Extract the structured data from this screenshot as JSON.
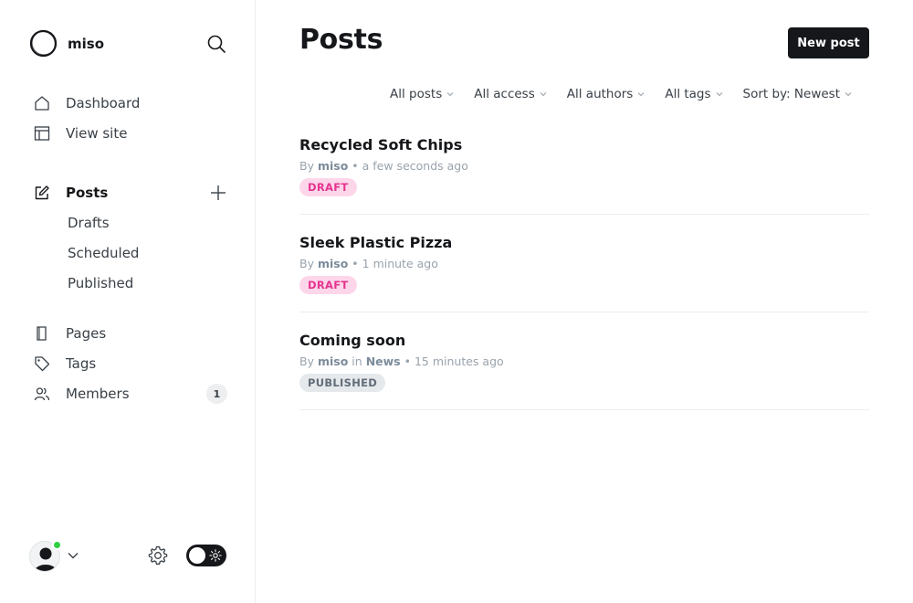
{
  "brand": {
    "name": "miso"
  },
  "nav": {
    "primary": [
      {
        "label": "Dashboard",
        "icon": "house-icon"
      },
      {
        "label": "View site",
        "icon": "layout-icon"
      }
    ],
    "posts": {
      "label": "Posts",
      "icon": "pencil-square-icon"
    },
    "post_subitems": [
      "Drafts",
      "Scheduled",
      "Published"
    ],
    "secondary": [
      {
        "label": "Pages",
        "icon": "page-icon"
      },
      {
        "label": "Tags",
        "icon": "tag-icon"
      },
      {
        "label": "Members",
        "icon": "members-icon",
        "count": "1"
      }
    ]
  },
  "main": {
    "title": "Posts",
    "new_post_label": "New post",
    "filters": [
      "All posts",
      "All access",
      "All authors",
      "All tags",
      "Sort by: Newest"
    ]
  },
  "posts": [
    {
      "title": "Recycled Soft Chips",
      "by": "By",
      "author": "miso",
      "in": "",
      "tag": "",
      "time": "a few seconds ago",
      "status": "DRAFT"
    },
    {
      "title": "Sleek Plastic Pizza",
      "by": "By",
      "author": "miso",
      "in": "",
      "tag": "",
      "time": "1 minute ago",
      "status": "DRAFT"
    },
    {
      "title": "Coming soon",
      "by": "By",
      "author": "miso",
      "in": "in",
      "tag": "News",
      "time": "15 minutes ago",
      "status": "PUBLISHED"
    }
  ],
  "colors": {
    "accent_dark": "#15171a",
    "draft_bg": "#fdd6ea",
    "draft_text": "#e4348f",
    "online": "#30cf43"
  }
}
